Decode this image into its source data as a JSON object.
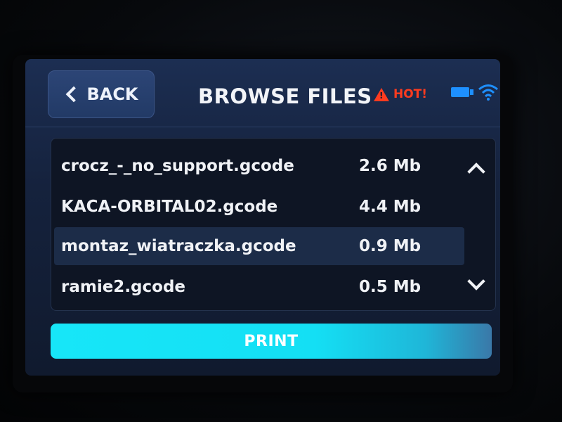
{
  "header": {
    "back_label": "BACK",
    "title": "BROWSE FILES",
    "warning_text": "HOT!"
  },
  "files": [
    {
      "name": "crocz_-_no_support.gcode",
      "size": "2.6 Mb",
      "selected": false
    },
    {
      "name": "KACA-ORBITAL02.gcode",
      "size": "4.4 Mb",
      "selected": false
    },
    {
      "name": "montaz_wiatraczka.gcode",
      "size": "0.9 Mb",
      "selected": true
    },
    {
      "name": "ramie2.gcode",
      "size": "0.5 Mb",
      "selected": false
    }
  ],
  "actions": {
    "print_label": "PRINT"
  },
  "icons": {
    "back": "chevron-left-icon",
    "warning": "warning-triangle-icon",
    "usb": "usb-drive-icon",
    "wifi": "wifi-icon",
    "scroll_up": "chevron-up-icon",
    "scroll_down": "chevron-down-icon"
  },
  "colors": {
    "accent": "#17e6f8",
    "warning": "#ff3b1f",
    "status_blue": "#1e90ff",
    "screen_bg": "#15223d"
  }
}
